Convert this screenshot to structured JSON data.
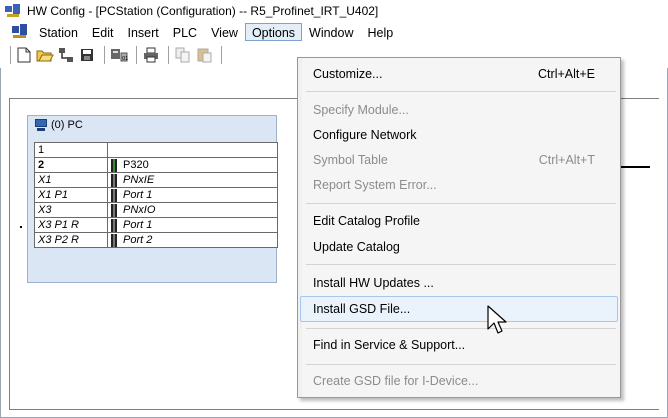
{
  "window": {
    "title": "HW Config - [PCStation (Configuration) -- R5_Profinet_IRT_U402]"
  },
  "menubar": {
    "items": [
      "Station",
      "Edit",
      "Insert",
      "PLC",
      "View",
      "Options",
      "Window",
      "Help"
    ],
    "active": "Options"
  },
  "toolbar": {
    "icons": [
      "new-icon",
      "open-icon",
      "network-icon",
      "save-icon",
      "compile-icon",
      "print-icon",
      "copy-icon",
      "paste-icon"
    ]
  },
  "station": {
    "title": "(0) PC",
    "table": {
      "header_row": [
        "1",
        ""
      ],
      "rows": [
        {
          "slot": "2",
          "module": "P320",
          "kind": "cpu"
        },
        {
          "slot": "X1",
          "module": "PNxIE",
          "kind": "sub"
        },
        {
          "slot": "X1 P1",
          "module": "Port 1",
          "kind": "sub"
        },
        {
          "slot": "X3",
          "module": "PNxIO",
          "kind": "sub"
        },
        {
          "slot": "X3 P1 R",
          "module": "Port 1",
          "kind": "sub"
        },
        {
          "slot": "X3 P2 R",
          "module": "Port 2",
          "kind": "sub"
        }
      ]
    }
  },
  "options_menu": {
    "items": [
      {
        "label": "Customize...",
        "shortcut": "Ctrl+Alt+E",
        "disabled": false
      },
      {
        "label": "Specify Module...",
        "shortcut": "",
        "disabled": true
      },
      {
        "label": "Configure Network",
        "shortcut": "",
        "disabled": false
      },
      {
        "label": "Symbol Table",
        "shortcut": "Ctrl+Alt+T",
        "disabled": true
      },
      {
        "label": "Report System Error...",
        "shortcut": "",
        "disabled": true
      },
      {
        "label": "Edit Catalog Profile",
        "shortcut": "",
        "disabled": false
      },
      {
        "label": "Update Catalog",
        "shortcut": "",
        "disabled": false
      },
      {
        "label": "Install HW Updates ...",
        "shortcut": "",
        "disabled": false
      },
      {
        "label": "Install GSD File...",
        "shortcut": "",
        "disabled": false,
        "hover": true
      },
      {
        "label": "Find in Service & Support...",
        "shortcut": "",
        "disabled": false
      },
      {
        "label": "Create GSD file for I-Device...",
        "shortcut": "",
        "disabled": true
      }
    ]
  },
  "colors": {
    "menu_highlight": "#eaf2fb",
    "menu_border": "#a8c8ea",
    "disabled_text": "#8c8c8c",
    "rack_background": "#dbe6f4"
  }
}
